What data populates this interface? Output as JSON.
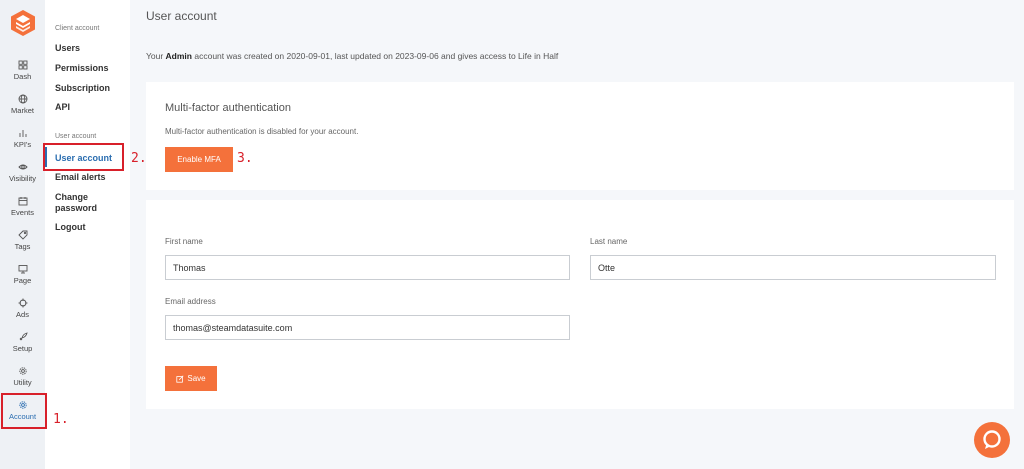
{
  "rail": {
    "items": [
      {
        "label": "Dash",
        "icon": "dashboard-icon"
      },
      {
        "label": "Market",
        "icon": "globe-icon"
      },
      {
        "label": "KPI's",
        "icon": "bar-chart-icon"
      },
      {
        "label": "Visibility",
        "icon": "eye-icon"
      },
      {
        "label": "Events",
        "icon": "calendar-icon"
      },
      {
        "label": "Tags",
        "icon": "tag-icon"
      },
      {
        "label": "Page",
        "icon": "monitor-icon"
      },
      {
        "label": "Ads",
        "icon": "crosshair-icon"
      },
      {
        "label": "Setup",
        "icon": "rocket-icon"
      },
      {
        "label": "Utility",
        "icon": "cog-icon"
      },
      {
        "label": "Account",
        "icon": "gear-icon"
      }
    ]
  },
  "subnav": {
    "client_heading": "Client account",
    "client_items": [
      "Users",
      "Permissions",
      "Subscription",
      "API"
    ],
    "user_heading": "User account",
    "user_items": [
      "User account",
      "Email alerts",
      "Change password",
      "Logout"
    ]
  },
  "page": {
    "title": "User account",
    "info_prefix": "Your ",
    "info_role": "Admin",
    "info_suffix": " account was created on 2020-09-01, last updated on 2023-09-06 and gives access to Life in Half"
  },
  "mfa": {
    "title": "Multi-factor authentication",
    "status": "Multi-factor authentication is disabled for your account.",
    "button": "Enable MFA"
  },
  "form": {
    "first_name_label": "First name",
    "first_name_value": "Thomas",
    "last_name_label": "Last name",
    "last_name_value": "Otte",
    "email_label": "Email address",
    "email_value": "thomas@steamdatasuite.com",
    "save_button": "Save"
  },
  "annotations": [
    "1.",
    "2.",
    "3."
  ],
  "colors": {
    "accent": "#f4713b",
    "active_link": "#2a6db0",
    "annotation": "#d8202a"
  }
}
